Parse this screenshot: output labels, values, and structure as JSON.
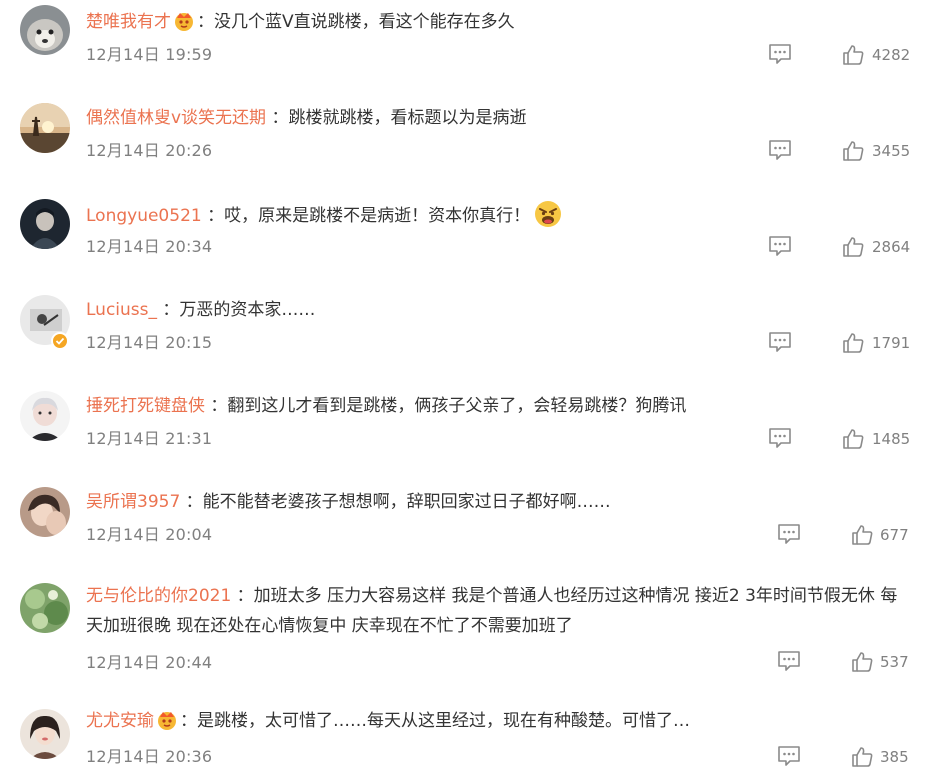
{
  "comments": [
    {
      "username": "楚唯我有才",
      "sep": "：",
      "text": "没几个蓝V直说跳楼，看这个能存在多久",
      "date": "12月14日 19:59",
      "likes": "4282"
    },
    {
      "username": "偶然值林叟v谈笑无还期",
      "sep": " ：",
      "text": "跳楼就跳楼，看标题以为是病逝",
      "date": "12月14日 20:26",
      "likes": "3455"
    },
    {
      "username": "Longyue0521",
      "sep": " ：",
      "text": "哎，原来是跳楼不是病逝！资本你真行！",
      "date": "12月14日 20:34",
      "likes": "2864"
    },
    {
      "username": "Luciuss_",
      "sep": " ：",
      "text": "万恶的资本家……",
      "date": "12月14日 20:15",
      "likes": "1791"
    },
    {
      "username": "捶死打死键盘侠",
      "sep": " ：",
      "text": "翻到这儿才看到是跳楼，俩孩子父亲了，会轻易跳楼？狗腾讯",
      "date": "12月14日 21:31",
      "likes": "1485"
    },
    {
      "username": "吴所谓3957",
      "sep": " ：",
      "text": "能不能替老婆孩子想想啊，辞职回家过日子都好啊……",
      "date": "12月14日 20:04",
      "likes": "677"
    },
    {
      "username": "无与伦比的你2021",
      "sep": " ：",
      "text": "加班太多 压力大容易这样 我是个普通人也经历过这种情况 接近2 3年时间节假无休 每天加班很晚 现在还处在心情恢复中 庆幸现在不忙了不需要加班了",
      "date": "12月14日 20:44",
      "likes": "537"
    },
    {
      "username": "尤尤安瑜",
      "sep": "：",
      "text": "是跳楼，太可惜了……每天从这里经过，现在有种酸楚。可惜了…",
      "date": "12月14日 20:36",
      "likes": "385"
    }
  ],
  "icons": {
    "reply": "comment-icon",
    "like": "thumbs-up-icon",
    "vip": "vip-crown-badge-icon",
    "angry": "angry-face-emoji-icon",
    "verified": "verified-badge-icon"
  },
  "colors": {
    "username": "#eb7350",
    "meta": "#808080",
    "text": "#333333",
    "verified": "#f5a623"
  }
}
